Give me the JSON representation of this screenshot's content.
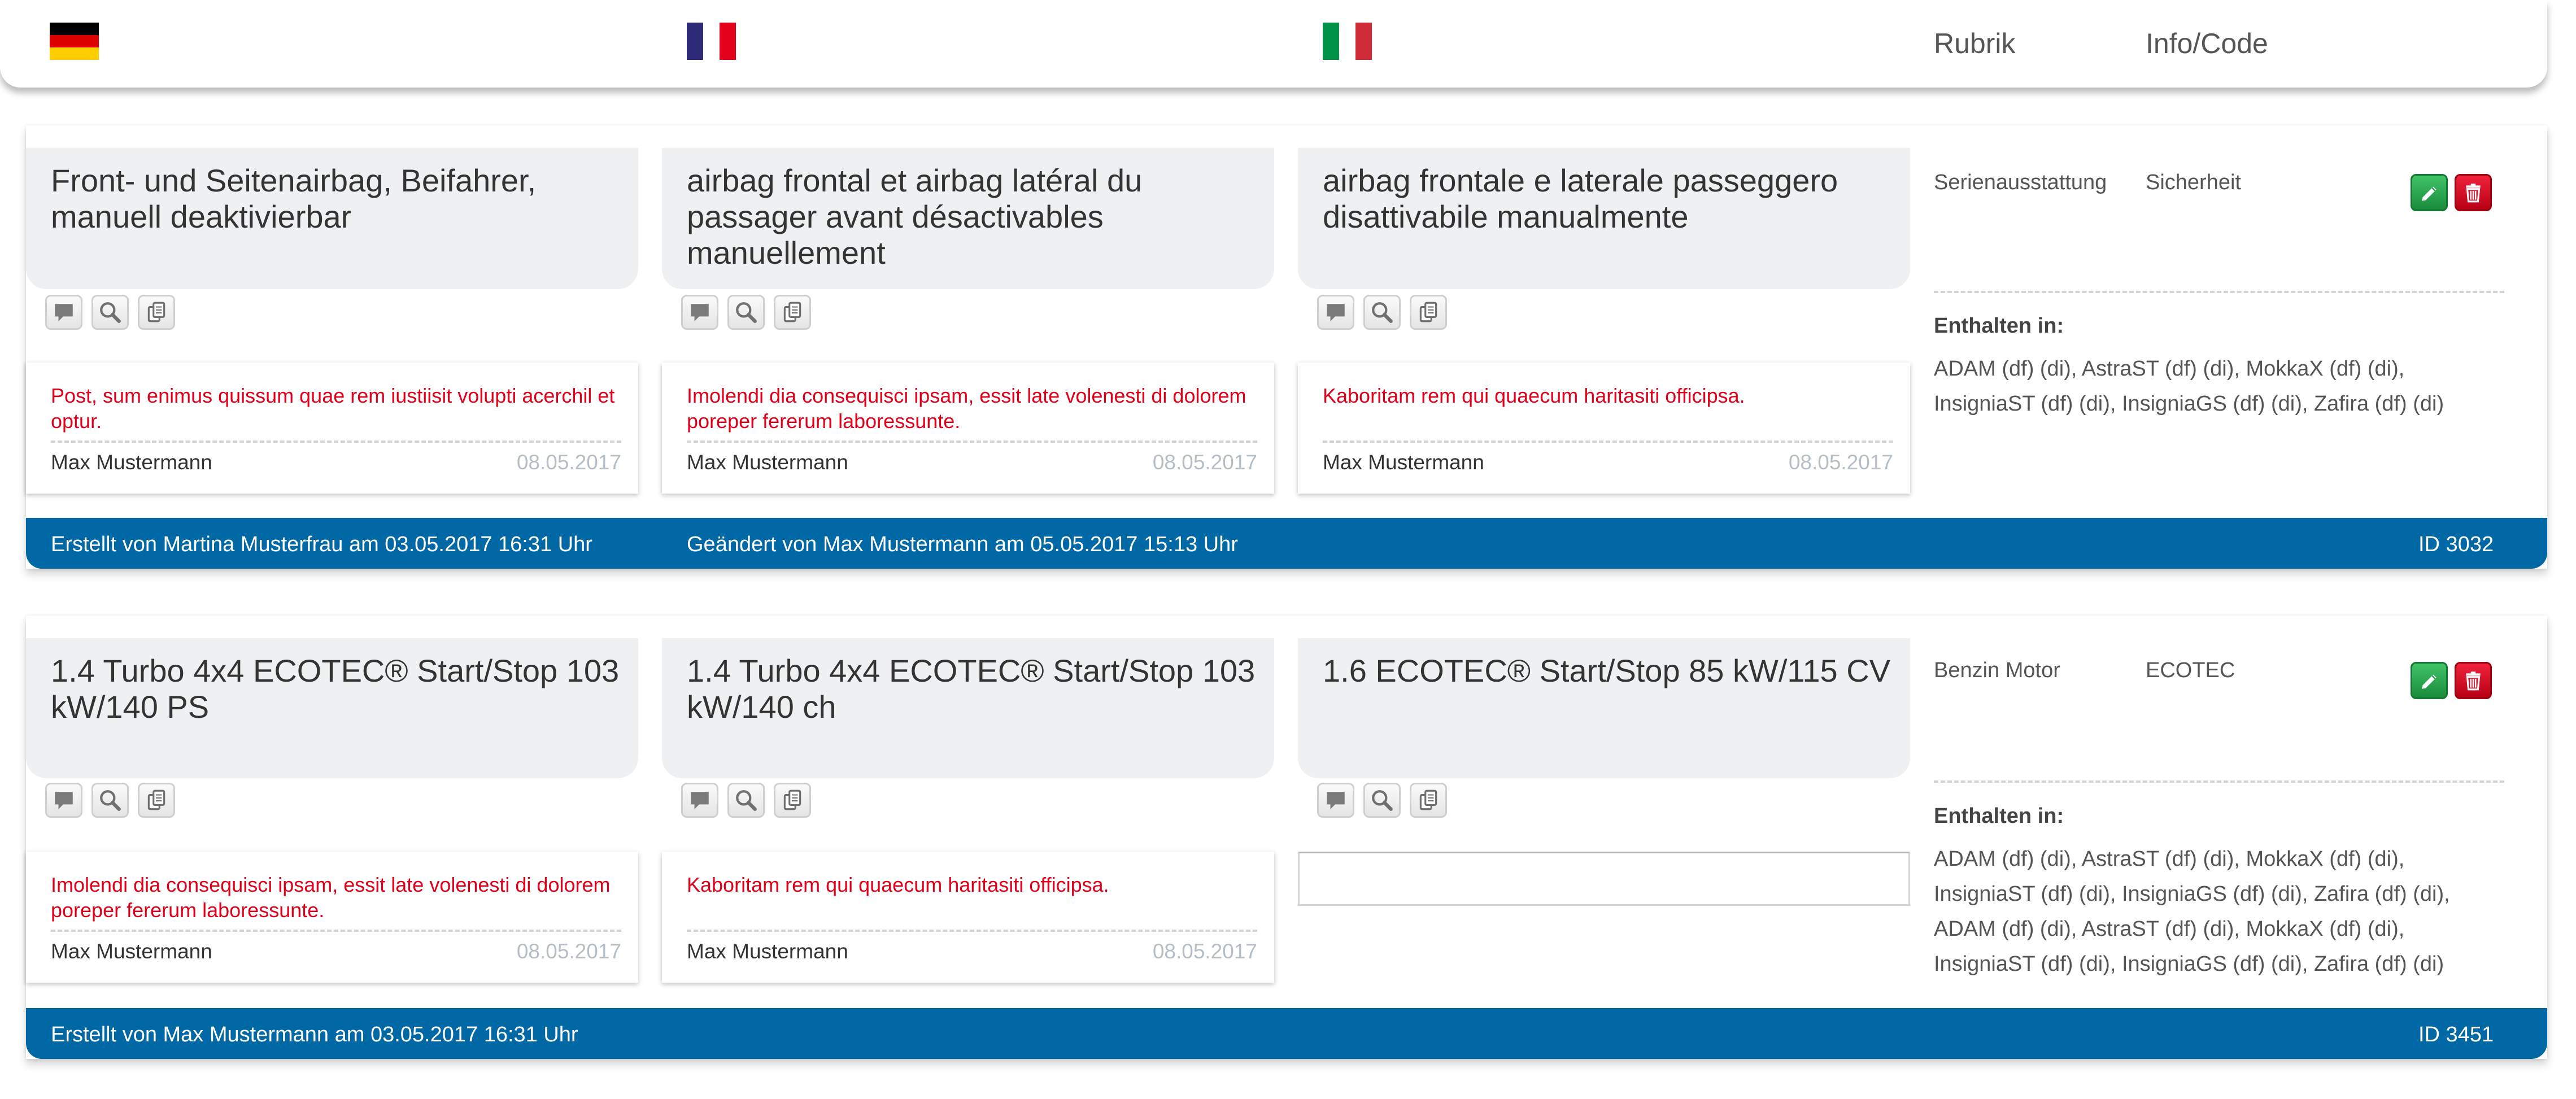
{
  "header": {
    "flags": [
      {
        "name": "flag-germany",
        "colors": [
          "#000000",
          "#dd0000",
          "#ffce00"
        ]
      },
      {
        "name": "flag-france",
        "colors": [
          "#2d2a78",
          "#ffffff",
          "#e3001b"
        ]
      },
      {
        "name": "flag-italy",
        "colors": [
          "#009246",
          "#ffffff",
          "#ce2b37"
        ]
      }
    ],
    "rubrik_label": "Rubrik",
    "info_code_label": "Info/Code"
  },
  "colors": {
    "footer_blue": "#0068a5",
    "comment_red": "#e1001a",
    "edit_green": "#1fa347",
    "delete_red": "#e1001a",
    "translation_bg": "#eef0f1"
  },
  "icons": {
    "comment": "comment-icon",
    "search": "search-icon",
    "copy": "copy-icon",
    "edit": "pencil-icon",
    "delete": "trash-icon"
  },
  "entries": [
    {
      "translations": {
        "de": "Front- und Seitenairbag, Beifahrer, manuell deaktivierbar",
        "fr": "airbag frontal et airbag latéral du passager avant désactivables manuellement",
        "it": "airbag frontale e laterale passeggero disattivabile manualmente"
      },
      "comments": {
        "de": {
          "text": "Post, sum enimus quissum quae rem iustiisit volupti acerchil et optur.",
          "author": "Max Mustermann",
          "date": "08.05.2017"
        },
        "fr": {
          "text": "Imolendi dia consequisci ipsam, essit late volenesti di dolorem poreper fererum laboressunte.",
          "author": "Max Mustermann",
          "date": "08.05.2017"
        },
        "it": {
          "text": "Kaboritam rem qui quaecum haritasiti officipsa.",
          "author": "Max Mustermann",
          "date": "08.05.2017"
        }
      },
      "rubrik": "Serienausstattung",
      "info_code": "Sicherheit",
      "enthalten_label": "Enthalten in:",
      "enthalten": "ADAM (df) (di), AstraST (df) (di), MokkaX (df) (di), InsigniaST (df) (di), InsigniaGS (df) (di), Zafira (df) (di)",
      "footer": {
        "created": "Erstellt von Martina Musterfrau am 03.05.2017 16:31 Uhr",
        "changed": "Geändert von Max Mustermann am 05.05.2017 15:13 Uhr",
        "id": "ID 3032"
      }
    },
    {
      "translations": {
        "de": "1.4 Turbo 4x4 ECOTEC® Start/Stop 103 kW/140 PS",
        "fr": "1.4 Turbo 4x4 ECOTEC® Start/Stop 103 kW/140 ch",
        "it": "1.6 ECOTEC® Start/Stop 85 kW/115 CV"
      },
      "comments": {
        "de": {
          "text": "Imolendi dia consequisci ipsam, essit late volenesti di dolorem poreper fererum laboressunte.",
          "author": "Max Mustermann",
          "date": "08.05.2017"
        },
        "fr": {
          "text": "Kaboritam rem qui quaecum haritasiti officipsa.",
          "author": "Max Mustermann",
          "date": "08.05.2017"
        },
        "it_placeholder": ""
      },
      "rubrik": "Benzin Motor",
      "info_code": "ECOTEC",
      "enthalten_label": "Enthalten in:",
      "enthalten": "ADAM (df) (di), AstraST (df) (di), MokkaX (df) (di), InsigniaST (df) (di), InsigniaGS (df) (di), Zafira (df) (di), ADAM (df) (di), AstraST (df) (di), MokkaX (df) (di), InsigniaST (df) (di), InsigniaGS (df) (di), Zafira (df) (di)",
      "footer": {
        "created": "Erstellt von Max Mustermann am 03.05.2017 16:31 Uhr",
        "id": "ID 3451"
      }
    }
  ]
}
